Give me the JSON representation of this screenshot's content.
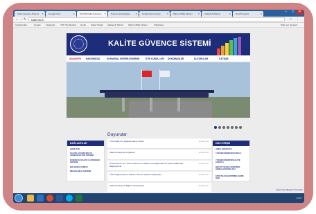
{
  "browser": {
    "tabs": [
      {
        "label": "Kalite Güvence Sistemi"
      },
      {
        "label": "Google Drive"
      },
      {
        "label": "KALİTE Kalite Güvence"
      },
      {
        "label": "Sunucu Giriş Sayfası"
      },
      {
        "label": "Gmail Gelen Kutusu"
      },
      {
        "label": "Öğrenci Bilgi Sistemi"
      },
      {
        "label": "Akademik Takvim"
      },
      {
        "label": "Ders Programı"
      }
    ],
    "url": "kalite.edu.tr",
    "bookmarks": [
      "Uygulamalar",
      "Google",
      "Facebook",
      "YÖK Tez Merkezi",
      "Gmail",
      "Haber Portalı",
      "Akademik Takvim",
      "Öğrenci Bilgi Sistemi",
      "Kütüphane",
      "Diğer yer işaretleri"
    ]
  },
  "site": {
    "title": "KALİTE GÜVENCE SİSTEMİ",
    "nav": [
      "ANASAYFA",
      "HAKKIMIZDA",
      "KURUMSAL DEĞERLENDİRME",
      "ETİK KURULLARI",
      "DOKÜMANLAR",
      "DUYURULAR",
      "İLETİŞİM"
    ],
    "slider_dots": 7,
    "slider_active": 0
  },
  "left_panel": {
    "heading": "BAĞLANTILAR",
    "items": [
      "ADEK ATS",
      "KALİTE GÜVENCESİ VE AKREDİTASYON SİSTEMİ",
      "KURUM İÇİ KALİTE GÜVENCESİ SİSTEMİ",
      "BOLOGNA SÜRECİ",
      "MEZUN BİLGİ SİSTEMİ"
    ]
  },
  "right_panel": {
    "heading": "HIZLI ERİŞİM",
    "items": [
      "ADEK ANASAYFA",
      "YÜKSEKÖĞRETİM KURULU",
      "YÜKSEKÖĞRETİM KALİTE KURULU",
      "BEYAZ VE MALİ KONTROL GENEL MÜDÜRLÜĞÜ",
      "STRATEJİ GELİŞTİRME DAİRE BŞK."
    ]
  },
  "announcements": {
    "title": "Duyurular",
    "items": [
      {
        "text": "YÖK Kalite Dış Değerlendirme Süreci",
        "date": "20 Mart 2017"
      },
      {
        "text": "Kalite Komisyonu Toplantısı",
        "date": "20 Mart 2017"
      },
      {
        "text": "Üniversitemiz Tez Yazım Kılavuzu ve Kalite Dış Değerlendirme Süreci Hakkında Bilgilendirme",
        "date": "20 Mart 2017"
      },
      {
        "text": "YÖK Değerlendirme Takvimi Üzerine Yapılan Çalışmalar",
        "date": "20 Mart 2017"
      },
      {
        "text": "Kalite Komisyonu Eğitimi Tamamlandı",
        "date": "20 Mart 2017"
      }
    ]
  },
  "footer": {
    "text": "Abant İzzet Baysal Üniversitesi"
  },
  "taskbar": {
    "icons": [
      "windows-start",
      "file-explorer",
      "outlook",
      "chrome",
      "word",
      "skype",
      "excel"
    ],
    "clock": "14:25"
  },
  "colors": {
    "navy": "#1d2d7a",
    "active_red": "#c81d1d",
    "frame_pink": "#cf8585"
  }
}
